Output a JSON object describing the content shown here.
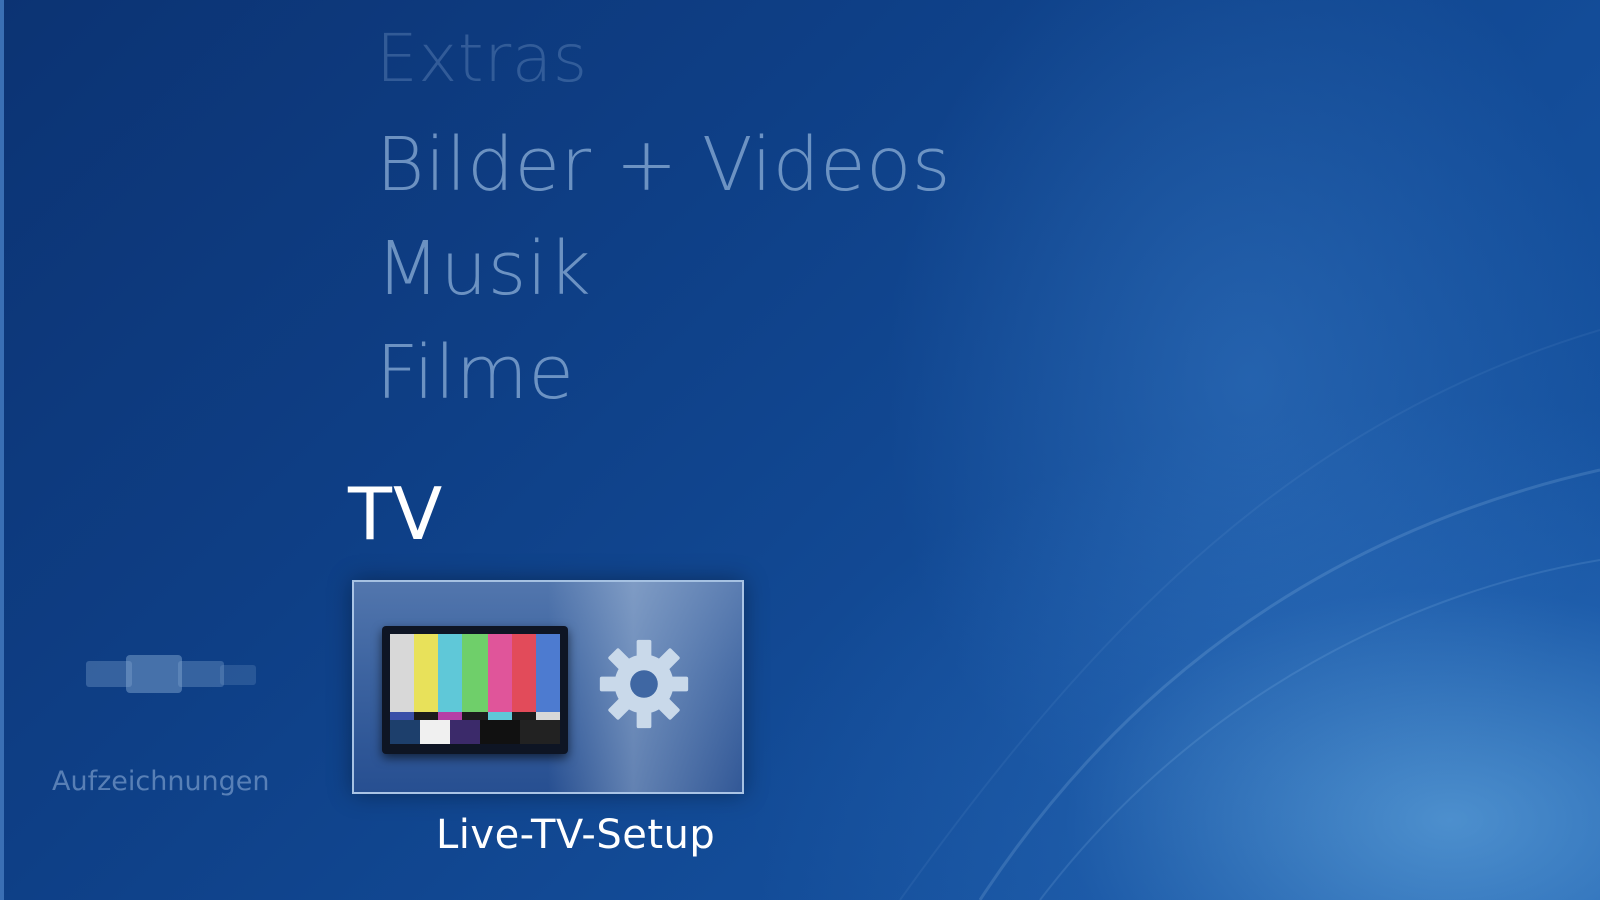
{
  "menu": {
    "items": [
      {
        "label": "Extras"
      },
      {
        "label": "Bilder + Videos"
      },
      {
        "label": "Musik"
      },
      {
        "label": "Filme"
      }
    ],
    "active_section": "TV"
  },
  "tv_row": {
    "items": [
      {
        "label": "Aufzeichnungen",
        "icon": "recordings-icon"
      },
      {
        "label": "Live-TV-Setup",
        "icon": "tv-setup-icon",
        "selected": true
      }
    ]
  },
  "colors": {
    "background": "#0e3f86",
    "menu_text": "#8cafd7",
    "selected_text": "#ffffff"
  }
}
